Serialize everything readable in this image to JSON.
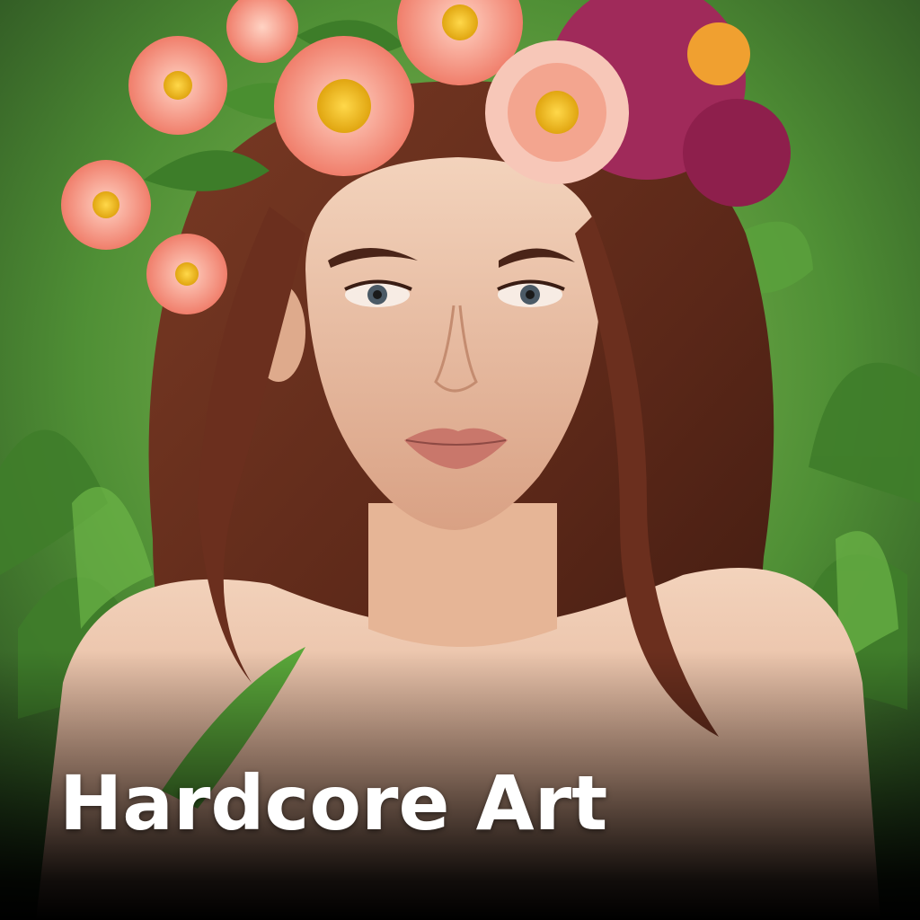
{
  "card": {
    "caption": "Hardcore Art"
  },
  "colors": {
    "background_green": "#4f8f35",
    "hair_brown": "#6b2f1e",
    "skin": "#e9b89a",
    "flower_salmon": "#f4907a",
    "flower_magenta": "#a02a5a",
    "flower_center": "#f2c21b",
    "caption_text": "#ffffff"
  }
}
